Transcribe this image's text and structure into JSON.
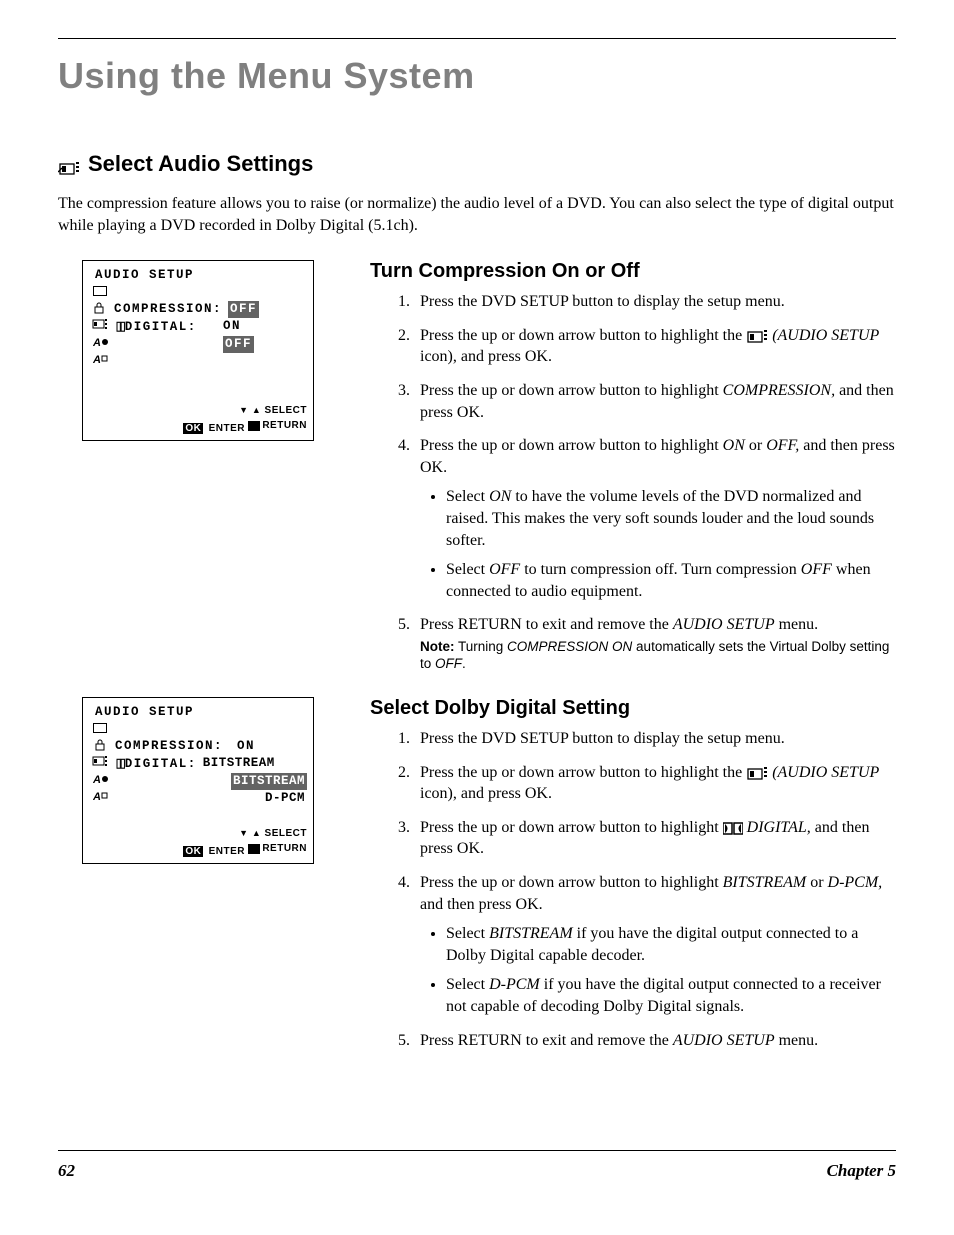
{
  "chapter_head": "Using the Menu System",
  "section_head": "Select Audio Settings",
  "intro": "The compression feature allows you to raise (or normalize) the audio level of a DVD. You can also select the type of digital output while playing a DVD recorded in Dolby Digital (5.1ch).",
  "osd1": {
    "title": "AUDIO SETUP",
    "row1_label": "COMPRESSION:",
    "row1_val": "OFF",
    "row2_label_prefix": "DIGITAL:",
    "row2_opt1": "ON",
    "row2_opt2": "OFF",
    "footer_select": "SELECT",
    "footer_ok": "OK",
    "footer_enter": "ENTER",
    "footer_return": "RETURN"
  },
  "sub1_head": "Turn Compression On or Off",
  "sub1_steps": {
    "s1": "Press the DVD SETUP button to display the setup menu.",
    "s2a": "Press the up or down arrow button to highlight the ",
    "s2b": " (AUDIO SETUP",
    "s2c": " icon), and press OK.",
    "s3a": "Press the up or down arrow button to highlight ",
    "s3b": "COMPRESSION,",
    "s3c": " and then press OK.",
    "s4a": "Press the up or down arrow button to highlight ",
    "s4b": "ON",
    "s4c": " or ",
    "s4d": "OFF,",
    "s4e": " and then press OK.",
    "b1a": "Select ",
    "b1b": "ON",
    "b1c": " to have the volume levels of the DVD normalized and raised. This makes the very soft sounds louder and the loud sounds softer.",
    "b2a": "Select ",
    "b2b": "OFF",
    "b2c": " to turn compression off. Turn compression ",
    "b2d": "OFF",
    "b2e": " when connected to audio equipment.",
    "s5a": "Press RETURN to exit and remove the ",
    "s5b": "AUDIO SETUP",
    "s5c": " menu.",
    "note_label": "Note:",
    "note_a": " Turning ",
    "note_b": "COMPRESSION ON",
    "note_c": " automatically sets the Virtual Dolby setting to ",
    "note_d": "OFF",
    "note_e": "."
  },
  "osd2": {
    "title": "AUDIO SETUP",
    "row1_label": "COMPRESSION:",
    "row1_val": "ON",
    "row2_label_prefix": "DIGITAL:",
    "row2_val": "BITSTREAM",
    "opt1": "BITSTREAM",
    "opt2": "D-PCM",
    "footer_select": "SELECT",
    "footer_ok": "OK",
    "footer_enter": "ENTER",
    "footer_return": "RETURN"
  },
  "sub2_head": "Select Dolby Digital Setting",
  "sub2_steps": {
    "s1": "Press the DVD SETUP button to display the setup menu.",
    "s2a": "Press the up or down arrow button to highlight the ",
    "s2b": " (AUDIO SETUP",
    "s2c": " icon), and press OK.",
    "s3a": "Press the up or down arrow button to highlight ",
    "s3b": " DIGITAL,",
    "s3c": " and then press OK.",
    "s4a": "Press the up or down arrow button to highlight ",
    "s4b": "BITSTREAM",
    "s4c": " or ",
    "s4d": "D-PCM,",
    "s4e": " and then press OK.",
    "b1a": "Select ",
    "b1b": "BITSTREAM",
    "b1c": " if you have the digital output connected to a Dolby Digital capable decoder.",
    "b2a": "Select ",
    "b2b": "D-PCM",
    "b2c": " if you have the digital output connected to a receiver not capable of decoding Dolby Digital signals.",
    "s5a": "Press RETURN to exit and remove the ",
    "s5b": "AUDIO SETUP",
    "s5c": " menu."
  },
  "footer": {
    "page": "62",
    "chapter": "Chapter 5"
  }
}
